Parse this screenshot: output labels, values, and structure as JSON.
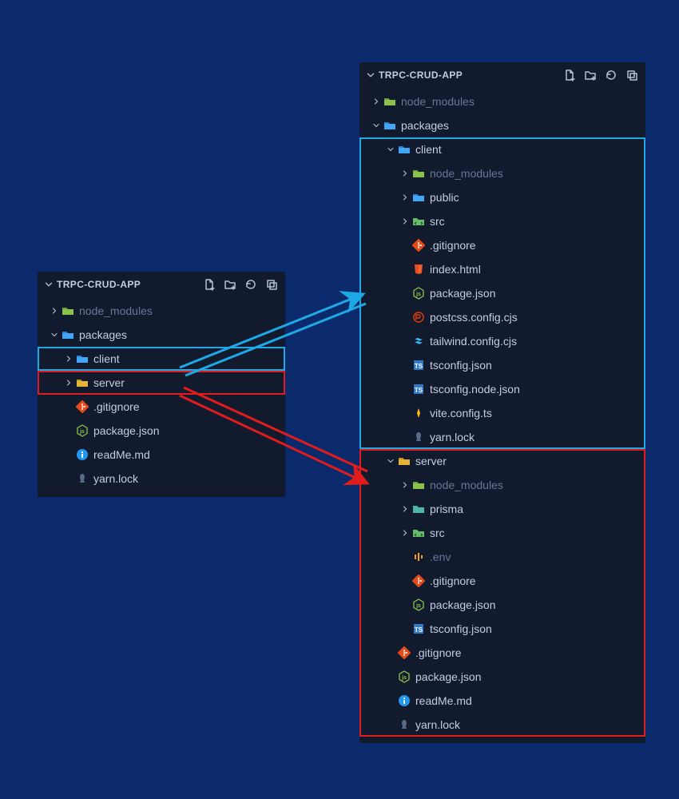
{
  "project_title": "TRPC-CRUD-APP",
  "left_panel": {
    "items": {
      "node_modules": "node_modules",
      "packages": "packages",
      "client": "client",
      "server": "server",
      "gitignore": ".gitignore",
      "package_json": "package.json",
      "readme": "readMe.md",
      "yarn_lock": "yarn.lock"
    }
  },
  "right_panel": {
    "items": {
      "node_modules": "node_modules",
      "packages": "packages",
      "client": "client",
      "client_node_modules": "node_modules",
      "client_public": "public",
      "client_src": "src",
      "client_gitignore": ".gitignore",
      "client_index_html": "index.html",
      "client_package_json": "package.json",
      "client_postcss": "postcss.config.cjs",
      "client_tailwind": "tailwind.config.cjs",
      "client_tsconfig": "tsconfig.json",
      "client_tsconfig_node": "tsconfig.node.json",
      "client_vite": "vite.config.ts",
      "client_yarn_lock": "yarn.lock",
      "server": "server",
      "server_node_modules": "node_modules",
      "server_prisma": "prisma",
      "server_src": "src",
      "server_env": ".env",
      "server_gitignore": ".gitignore",
      "server_package_json": "package.json",
      "server_tsconfig": "tsconfig.json",
      "root_gitignore": ".gitignore",
      "root_package_json": "package.json",
      "root_readme": "readMe.md",
      "root_yarn_lock": "yarn.lock"
    }
  }
}
